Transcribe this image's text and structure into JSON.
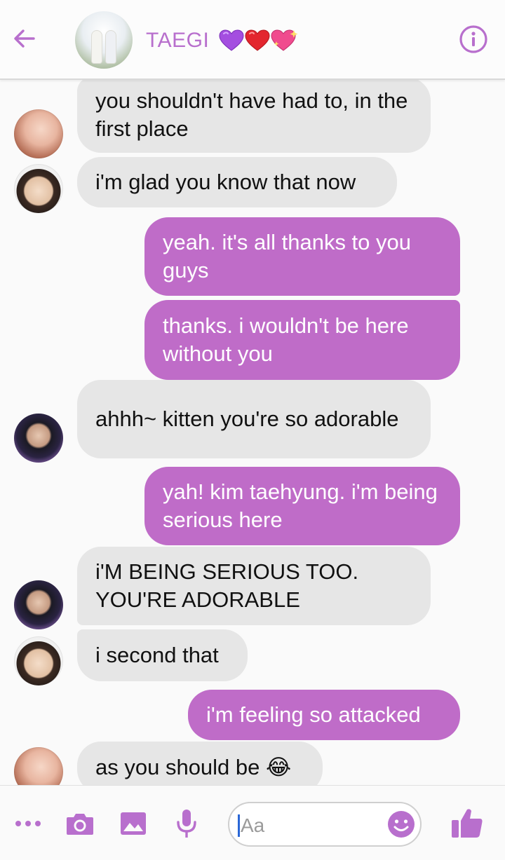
{
  "header": {
    "title": "TAEGI",
    "hearts": [
      "💜",
      "❤️",
      "💖"
    ],
    "back_icon": "arrow-left-icon",
    "info_icon": "info-icon"
  },
  "colors": {
    "accent": "#b86fcd",
    "outgoing_bubble": "#bf6cc8",
    "incoming_bubble": "#e6e6e6"
  },
  "messages": [
    {
      "sender": "incoming",
      "text": "you shouldn't have had to, in the first place"
    },
    {
      "sender": "incoming",
      "text": "i'm glad you know that now"
    },
    {
      "sender": "outgoing",
      "text": "yeah. it's all thanks to you guys"
    },
    {
      "sender": "outgoing",
      "text": "thanks. i wouldn't be here without you"
    },
    {
      "sender": "incoming",
      "text": "ahhh~ kitten you're so adorable"
    },
    {
      "sender": "outgoing",
      "text": "yah! kim taehyung. i'm being serious here"
    },
    {
      "sender": "incoming",
      "text": "i'M BEING SERIOUS TOO. YOU'RE ADORABLE"
    },
    {
      "sender": "incoming",
      "text": "i second that"
    },
    {
      "sender": "outgoing",
      "text": "i'm feeling so attacked"
    },
    {
      "sender": "incoming",
      "text": "as you should be 😂"
    }
  ],
  "composer": {
    "placeholder": "Aa",
    "icons": [
      "more-icon",
      "camera-icon",
      "gallery-icon",
      "microphone-icon",
      "emoji-icon",
      "thumbs-up-icon"
    ]
  }
}
